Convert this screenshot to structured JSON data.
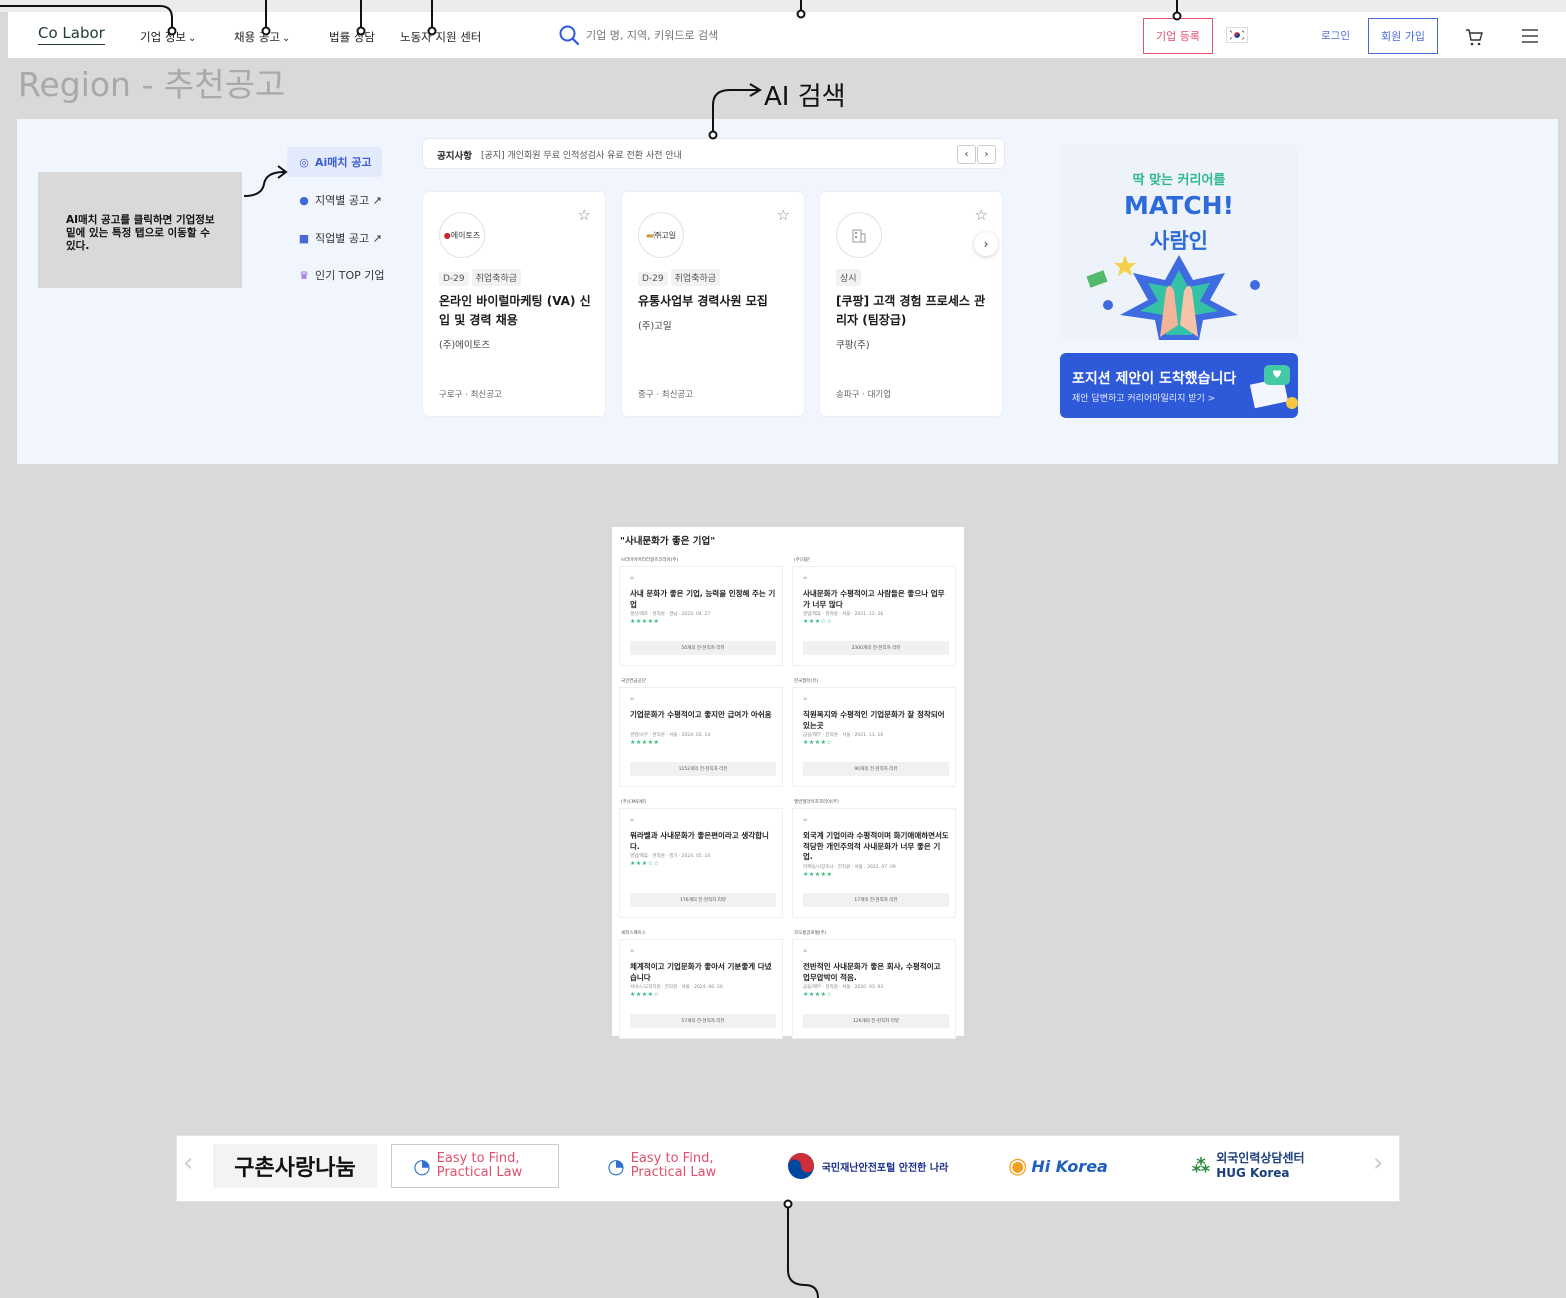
{
  "nav": {
    "logo": "Co Labor",
    "menu": [
      "기업 정보",
      "채용 공고",
      "법률 상담",
      "노동자 지원 센터"
    ],
    "search_placeholder": "기업 명, 지역, 키워드로 검색",
    "company_register": "기업 등록",
    "login": "로그인",
    "signup": "회원 가입"
  },
  "page_title": "Region - 추천공고",
  "annotation": {
    "ai_search": "AI 검색",
    "note": "AI매치 공고를 클릭하면 기업정보 밑에 있는 특정 탭으로 이동할 수 있다."
  },
  "categories": [
    "Ai매치 공고",
    "지역별 공고 ↗",
    "직업별 공고 ↗",
    "인기 TOP 기업"
  ],
  "notice": {
    "label": "공지사항",
    "text": "[공지] 개인회원 무료 인적성검사 유료 전환 사전 안내",
    "prev": "‹",
    "next": "›"
  },
  "jobs": [
    {
      "logo": "에이토즈",
      "tags": [
        "D-29",
        "취업축하금"
      ],
      "title": "온라인 바이럴마케팅 (VA) 신입 및 경력 채용",
      "company": "(주)에이토즈",
      "footer": "구로구 · 최신공고"
    },
    {
      "logo": "㈜고일",
      "tags": [
        "D-29",
        "취업축하금"
      ],
      "title": "유통사업부 경력사원 모집",
      "company": "(주)고일",
      "footer": "중구 · 최신공고"
    },
    {
      "logo": "",
      "tags": [
        "상시"
      ],
      "title": "[쿠팡] 고객 경험 프로세스 관리자 (팀장급)",
      "company": "쿠팡(주)",
      "footer": "송파구 · 대기업"
    }
  ],
  "banner1": {
    "line1": "딱 맞는 커리어를",
    "line2": "MATCH!",
    "line3": "사람인"
  },
  "banner2": {
    "line1": "포지션 제안이 도착했습니다",
    "line2": "제안 답변하고 커리어마일리지 받기 >"
  },
  "culture": {
    "title": "\"사내문화가 좋은 기업\"",
    "reviews": [
      {
        "company": "브라이어머티리얼즈코리아(주)",
        "title": "사내 문화가 좋은 기업, 능력을 인정해 주는 기업",
        "meta": "생산/제조 · 현직원 · 경남 · 2023. 04. 27",
        "stars": "★★★★★",
        "button": "50개의 전·현직자 리뷰"
      },
      {
        "company": "(주)대문",
        "title": "사내문화가 수평적이고 사람들은 좋으나 업무가 너무 많다",
        "meta": "영업/제휴 · 현직원 · 서울 · 2021. 12. 26",
        "stars": "★★★☆☆",
        "button": "2300개의 전·현직자 리뷰"
      },
      {
        "company": "국민연금공단",
        "title": "기업문화가 수평적이고 좋지만 급여가 아쉬움",
        "meta": "경영/사무 · 현직원 · 서울 · 2024. 02. 14",
        "stars": "★★★★★",
        "button": "1152개의 전·현직자 리뷰"
      },
      {
        "company": "한국필터(유)",
        "title": "직원복지와 수평적인 기업문화가 잘 정착되어 있는곳",
        "meta": "금융/재무 · 전직원 · 서울 · 2021. 11. 16",
        "stars": "★★★★☆",
        "button": "90개의 전·현직자 리뷰"
      },
      {
        "company": "(주)CMS에듀",
        "title": "워라벨과 사내문화가 좋은편이라고 생각합니다.",
        "meta": "영업/제휴 · 현직원 · 경기 · 2024. 05. 10",
        "stars": "★★★☆☆",
        "button": "176개의 전·현직자 리뷰"
      },
      {
        "company": "엘빈엘라이프코리아(주)",
        "title": "외국계 기업이라 수평적이며 화기애애하면서도 적당한 개인주의적 사내문화가 너무 좋은 기업.",
        "meta": "마케팅/시장조사 · 전직원 · 서울 · 2022. 07. 09",
        "stars": "★★★★★",
        "button": "17개의 전·현직자 리뷰"
      },
      {
        "company": "세피스페이스",
        "title": "체계적이고 기업문화가 좋아서 기분좋게 다녔습니다",
        "meta": "서비스/고객지원 · 전직원 · 서울 · 2024. 06. 20",
        "stars": "★★★★☆",
        "button": "57개의 전·현직자 리뷰"
      },
      {
        "company": "코오롱글로벌(주)",
        "title": "전반적인 사내문화가 좋은 회사, 수평적이고 업무압박이 적음.",
        "meta": "금융/재무 · 현직원 · 서울 · 2020. 03. 03",
        "stars": "★★★★☆",
        "button": "126개의 전·현직자 리뷰"
      }
    ]
  },
  "partners": {
    "prev": "‹",
    "next": "›",
    "items": [
      {
        "name": "구촌사랑나눔",
        "color": "#111111"
      },
      {
        "name": "Easy to Find, Practical Law",
        "color": "#e0506b"
      },
      {
        "name": "Easy to Find, Practical Law",
        "color": "#e0506b"
      },
      {
        "name": "국민재난안전포털 안전한 나라",
        "color": "#1b2f8a"
      },
      {
        "name": "Hi Korea",
        "color": "#1f5fbf"
      },
      {
        "name": "외국인력상담센터 HUG Korea",
        "color": "#1b3f7a"
      }
    ]
  }
}
